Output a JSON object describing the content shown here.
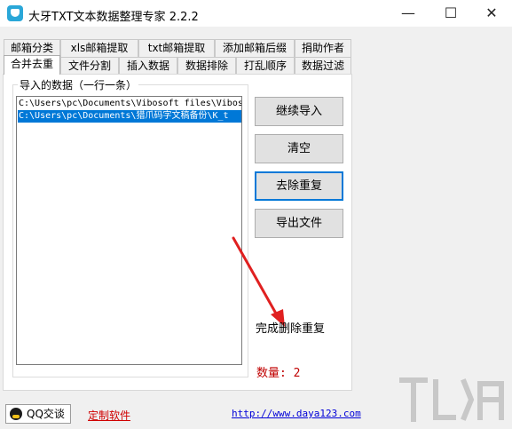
{
  "window": {
    "title": "大牙TXT文本数据整理专家 2.2.2",
    "controls": {
      "minimize": "—",
      "maximize": "☐",
      "close": "✕"
    }
  },
  "tabs_row1": [
    "邮箱分类",
    "xls邮箱提取",
    "txt邮箱提取",
    "添加邮箱后缀",
    "捐助作者"
  ],
  "tabs_row2": [
    "合并去重",
    "文件分割",
    "插入数据",
    "数据排除",
    "打乱顺序",
    "数据过滤"
  ],
  "active_tab": "合并去重",
  "import_group": {
    "label": "导入的数据（一行一条）",
    "items": [
      {
        "text": "C:\\Users\\pc\\Documents\\Vibosoft files\\Vibos",
        "selected": false
      },
      {
        "text": "C:\\Users\\pc\\Documents\\猎爪码字文稿备份\\K_t",
        "selected": true
      }
    ]
  },
  "buttons": {
    "continue_import": "继续导入",
    "clear": "清空",
    "dedupe": "去除重复",
    "export": "导出文件"
  },
  "status_text": "完成删除重复",
  "count_label": "数量: 2",
  "footer": {
    "qq_button": "QQ交谈",
    "custom_software": "定制软件",
    "website": "http://www.daya123.com"
  },
  "colors": {
    "selection": "#0078d7",
    "count_text": "#c00000",
    "custom_link": "#d00000",
    "site_link": "#0000d8",
    "arrow": "#e02020"
  }
}
